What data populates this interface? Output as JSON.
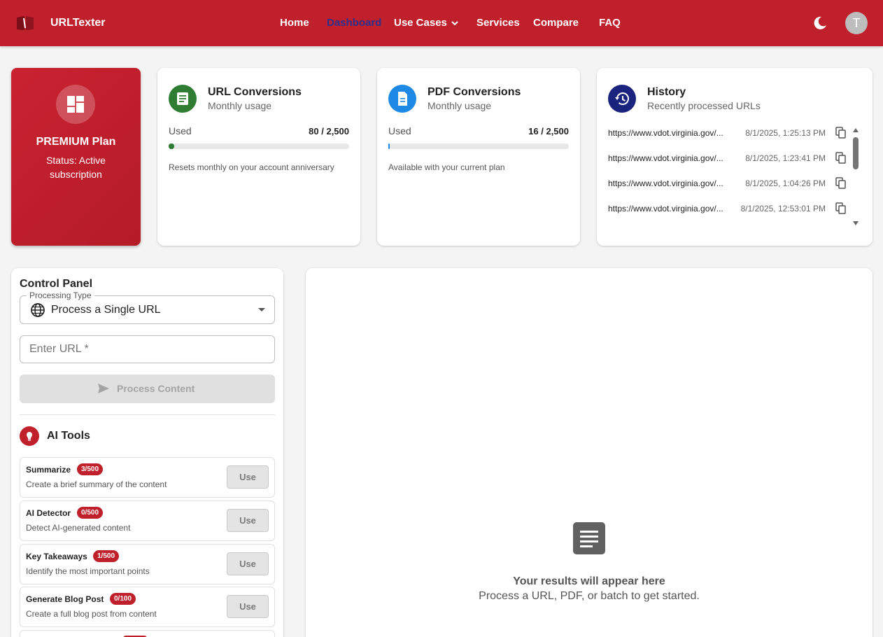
{
  "app": {
    "brand": "URLTexter"
  },
  "nav": {
    "home": "Home",
    "dashboard": "Dashboard",
    "use_cases": "Use Cases",
    "services": "Services",
    "compare": "Compare",
    "faq": "FAQ",
    "avatar_initial": "T"
  },
  "plan": {
    "name": "PREMIUM Plan",
    "status": "Status: Active subscription"
  },
  "url_conversions": {
    "title": "URL Conversions",
    "subtitle": "Monthly usage",
    "used_label": "Used",
    "used_value": "80 / 2,500",
    "used": 80,
    "limit": 2500,
    "note": "Resets monthly on your account anniversary",
    "color": "#2e7d32"
  },
  "pdf_conversions": {
    "title": "PDF Conversions",
    "subtitle": "Monthly usage",
    "used_label": "Used",
    "used_value": "16 / 2,500",
    "used": 16,
    "limit": 2500,
    "note": "Available with your current plan",
    "color": "#1e88e5"
  },
  "history": {
    "title": "History",
    "subtitle": "Recently processed URLs",
    "items": [
      {
        "url": "https://www.vdot.virginia.gov/...",
        "time": "8/1/2025, 1:25:13 PM"
      },
      {
        "url": "https://www.vdot.virginia.gov/...",
        "time": "8/1/2025, 1:23:41 PM"
      },
      {
        "url": "https://www.vdot.virginia.gov/...",
        "time": "8/1/2025, 1:04:26 PM"
      },
      {
        "url": "https://www.vdot.virginia.gov/...",
        "time": "8/1/2025, 12:53:01 PM"
      }
    ]
  },
  "control_panel": {
    "title": "Control Panel",
    "processing_type_label": "Processing Type",
    "processing_type_value": "Process a Single URL",
    "url_placeholder": "Enter URL *",
    "url_value": "",
    "process_button": "Process Content"
  },
  "ai_tools": {
    "title": "AI Tools",
    "use_label": "Use",
    "items": [
      {
        "name": "Summarize",
        "badge": "3/500",
        "desc": "Create a brief summary of the content"
      },
      {
        "name": "AI Detector",
        "badge": "0/500",
        "desc": "Detect AI-generated content"
      },
      {
        "name": "Key Takeaways",
        "badge": "1/500",
        "desc": "Identify the most important points"
      },
      {
        "name": "Generate Blog Post",
        "badge": "0/100",
        "desc": "Create a full blog post from content"
      }
    ]
  },
  "results": {
    "empty_title": "Your results will appear here",
    "empty_subtitle": "Process a URL, PDF, or batch to get started."
  },
  "colors": {
    "header": "#c0202c",
    "active_nav": "#2d2f8a",
    "history_icon": "#1a237e",
    "badge": "#c0202c"
  },
  "icons": {
    "logo": "book-logo-icon",
    "theme_toggle": "moon-icon",
    "plan": "dashboard-icon",
    "url_conversions": "article-icon",
    "pdf_conversions": "document-icon",
    "history": "history-icon",
    "copy": "copy-icon",
    "processing_type": "globe-icon",
    "process": "send-icon",
    "ai_tools": "brain-icon",
    "empty_results": "article-icon"
  }
}
